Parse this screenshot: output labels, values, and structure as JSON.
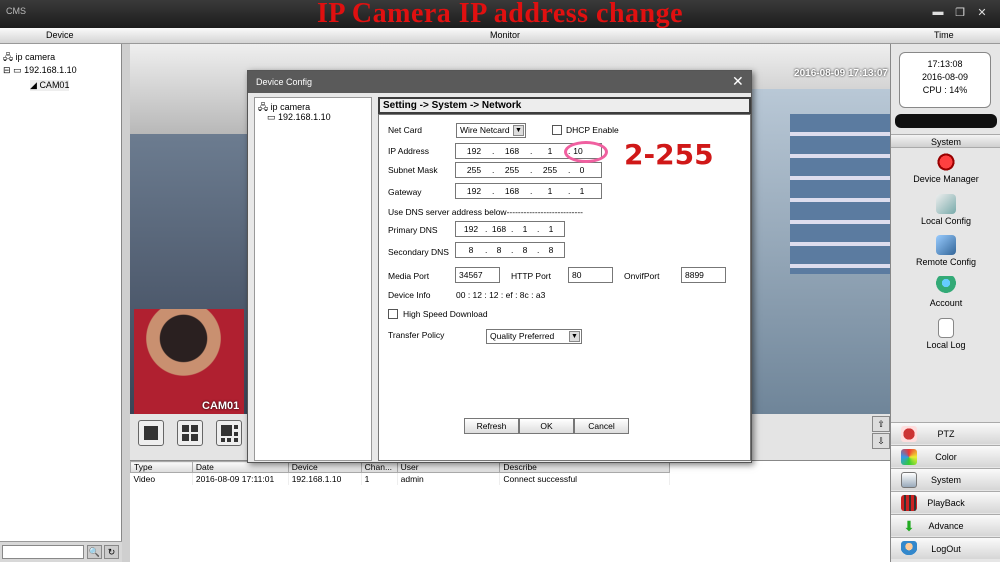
{
  "app": {
    "title": "CMS",
    "banner": "IP Camera IP address change"
  },
  "header": {
    "device": "Device",
    "monitor": "Monitor",
    "time": "Time"
  },
  "tree": {
    "root": "ip camera",
    "ip": "192.168.1.10",
    "camera": "CAM01"
  },
  "video": {
    "timestamp": "2016-08-09 17:13:07",
    "cam_label": "CAM01"
  },
  "clock": {
    "time": "17:13:08",
    "date": "2016-08-09",
    "cpu": "CPU : 14%"
  },
  "system_panel": {
    "header": "System",
    "items": [
      "Device Manager",
      "Local Config",
      "Remote Config",
      "Account",
      "Local Log"
    ]
  },
  "nav": [
    "PTZ",
    "Color",
    "System",
    "PlayBack",
    "Advance",
    "LogOut"
  ],
  "log": {
    "columns": [
      "Type",
      "Date",
      "Device",
      "Chan...",
      "User",
      "Describe"
    ],
    "rows": [
      [
        "Video",
        "2016-08-09 17:11:01",
        "192.168.1.10",
        "1",
        "admin",
        "Connect successful"
      ]
    ]
  },
  "dialog": {
    "title": "Device Config",
    "tree_root": "ip camera",
    "tree_ip": "192.168.1.10",
    "breadcrumb": "Setting -> System -> Network",
    "net_card_label": "Net Card",
    "net_card_value": "Wire Netcard",
    "dhcp_label": "DHCP Enable",
    "ip_label": "IP Address",
    "ip": [
      "192",
      "168",
      "1",
      "10"
    ],
    "mask_label": "Subnet Mask",
    "mask": [
      "255",
      "255",
      "255",
      "0"
    ],
    "gateway_label": "Gateway",
    "gateway": [
      "192",
      "168",
      "1",
      "1"
    ],
    "dns_note": "Use DNS server address below---------------------------",
    "pdns_label": "Primary DNS",
    "pdns": [
      "192",
      "168",
      "1",
      "1"
    ],
    "sdns_label": "Secondary DNS",
    "sdns": [
      "8",
      "8",
      "8",
      "8"
    ],
    "media_port_label": "Media Port",
    "media_port": "34567",
    "http_port_label": "HTTP Port",
    "http_port": "80",
    "onvif_label": "OnvifPort",
    "onvif_port": "8899",
    "device_info_label": "Device Info",
    "device_info": "00 :  12 :  12 :  ef  :  8c :  a3",
    "hsd_label": "High Speed Download",
    "transfer_label": "Transfer Policy",
    "transfer_value": "Quality Preferred",
    "refresh": "Refresh",
    "ok": "OK",
    "cancel": "Cancel"
  },
  "annotation": {
    "range": "2-255"
  }
}
